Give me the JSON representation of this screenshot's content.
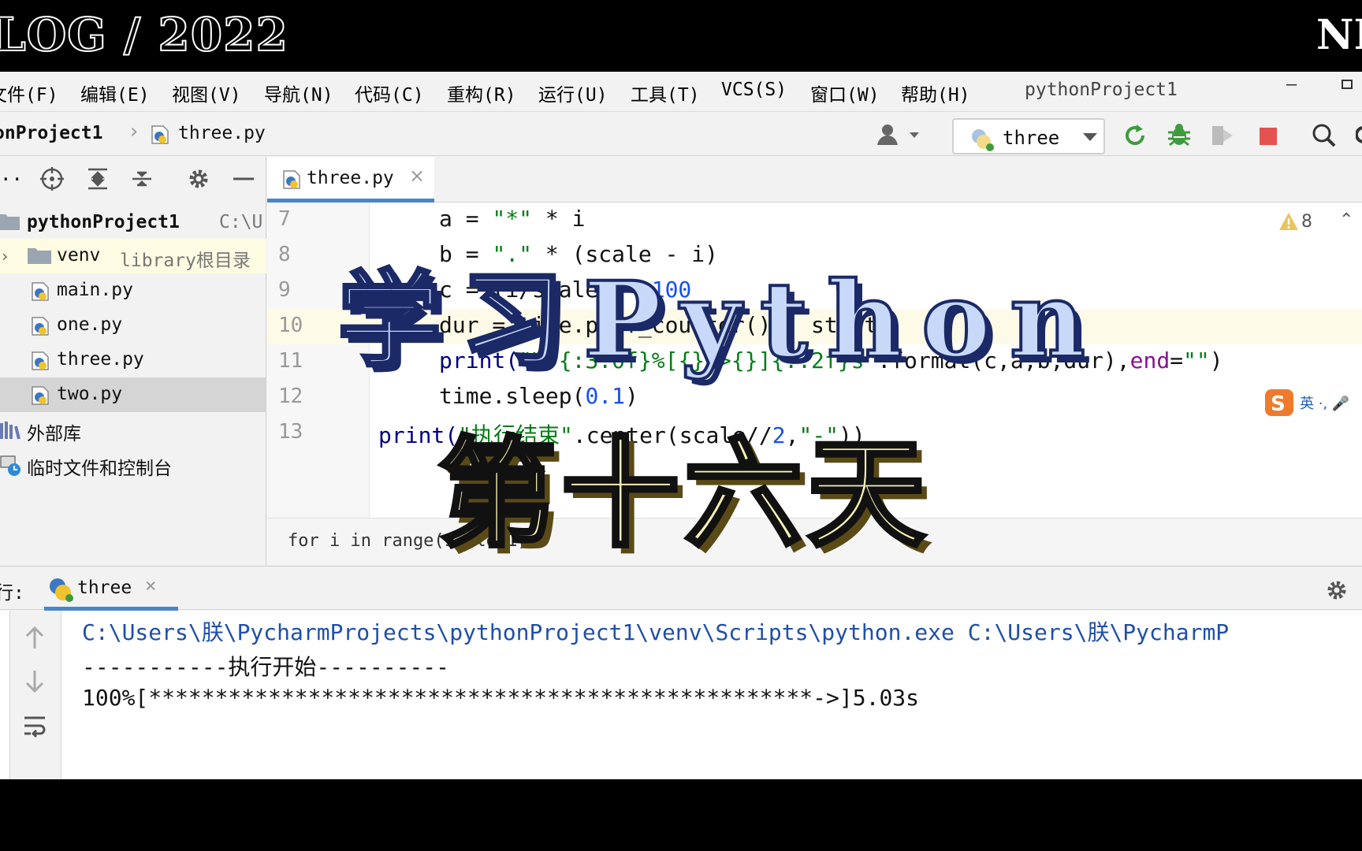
{
  "banner": {
    "left_text": "LOG / 2022",
    "right_text": "NI"
  },
  "menubar": {
    "items": [
      "文件(F)",
      "编辑(E)",
      "视图(V)",
      "导航(N)",
      "代码(C)",
      "重构(R)",
      "运行(U)",
      "工具(T)",
      "VCS(S)",
      "窗口(W)",
      "帮助(H)"
    ],
    "window_title": "pythonProject1"
  },
  "navbar": {
    "project": "onProject1",
    "file": "three.py",
    "run_config": "three"
  },
  "project_panel": {
    "toolbar_label": "..",
    "root": {
      "label": "pythonProject1",
      "hint": "C:\\U"
    },
    "items": [
      {
        "label": "venv",
        "hint": "library根目录"
      },
      {
        "label": "main.py"
      },
      {
        "label": "one.py"
      },
      {
        "label": "three.py"
      },
      {
        "label": "two.py"
      },
      {
        "label": "外部库"
      },
      {
        "label": "临时文件和控制台"
      }
    ]
  },
  "editor": {
    "tab_label": "three.py",
    "line_numbers": [
      "7",
      "8",
      "9",
      "10",
      "11",
      "12",
      "13"
    ],
    "lines": {
      "l7": {
        "a": "a = ",
        "b": "\"*\"",
        "c": " * i"
      },
      "l8": {
        "a": "b = ",
        "b": "\".\"",
        "c": " * (scale - i)"
      },
      "l9": {
        "a": "c = (i/scale) * ",
        "b": "100"
      },
      "l10": {
        "a": "dur = time.perf_counter() - start"
      },
      "l11": {
        "a": "print(",
        "b": "\"\\r{:3.0f}%[{}->{}]{:.2f}s\"",
        "c": ".format(c,a,b,dur),",
        "d": "end",
        "e": "=",
        "f": "\"\"",
        "g": ")"
      },
      "l12": {
        "a": "time.sleep(",
        "b": "0.1",
        "c": ")"
      },
      "l13": {
        "a": "print(",
        "b": "\"执行结束\"",
        "c": ".center(scale//",
        "d": "2",
        "e": ",",
        "f": "\"-\"",
        "g": "))"
      }
    },
    "warning_count": "8",
    "footer": "for i in range(scale+1)"
  },
  "run_panel": {
    "label": "行:",
    "tab_label": "three",
    "console": {
      "cmd": "C:\\Users\\朕\\PycharmProjects\\pythonProject1\\venv\\Scripts\\python.exe C:\\Users\\朕\\PycharmP",
      "start": "-----------执行开始----------",
      "progress": "100%[**************************************************->]5.03s"
    }
  },
  "overlay": {
    "title_1": "学习Python",
    "title_2": "第十六天"
  },
  "colors": {
    "accent": "#4a86c8",
    "string": "#067d17",
    "number": "#1750eb",
    "keyword": "#871094",
    "stop": "#e55252",
    "run": "#3f9b3f"
  },
  "icons": [
    "python-file-icon",
    "folder-icon",
    "locate-icon",
    "expand-all-icon",
    "collapse-all-icon",
    "gear-icon",
    "minimize-icon",
    "user-icon",
    "rerun-icon",
    "debug-icon",
    "coverage-icon",
    "stop-icon",
    "search-icon",
    "warning-icon",
    "arrow-up-icon",
    "arrow-down-icon",
    "soft-wrap-icon",
    "library-icon",
    "scratch-icon"
  ]
}
